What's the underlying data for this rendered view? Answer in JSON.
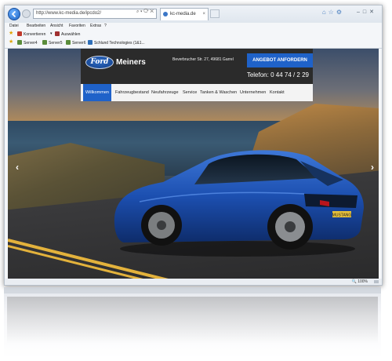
{
  "browser": {
    "address_url": "http://www.kc-media.de/ipcdo2/",
    "tab_title": "kc-media.de",
    "tab_close": "×",
    "menu": [
      "Datei",
      "Bearbeiten",
      "Ansicht",
      "Favoriten",
      "Extras",
      "?"
    ],
    "favorites_bar_1": {
      "items": [
        "Konvertieren",
        "Auswählen"
      ]
    },
    "favorites_bar_2": {
      "items": [
        "Server4",
        "Server5",
        "Server6",
        "Schlund Technologies (1&1..."
      ]
    },
    "zoom_level": "100%"
  },
  "site": {
    "logo_text": "Ford",
    "brand": "Meiners",
    "address": "Beverbrucher Str. 27, 49681 Garrel",
    "cta": "ANGEBOT ANFORDERN",
    "phone": "Telefon: 0 44 74 / 2 29",
    "nav": [
      {
        "label": "Willkommen",
        "active": true
      },
      {
        "label": "Fahrzeugbestand",
        "active": false
      },
      {
        "label": "Neufahrzeuge",
        "active": false
      },
      {
        "label": "Service",
        "active": false
      },
      {
        "label": "Tanken & Waschen",
        "active": false
      },
      {
        "label": "Unternehmen",
        "active": false
      },
      {
        "label": "Kontakt",
        "active": false
      }
    ],
    "plate_text": "MUSTANG"
  },
  "colors": {
    "accent": "#1f62c9",
    "header_bg": "#2b2b2b",
    "car_body": "#1c4fb0"
  },
  "icons": {
    "slider_prev": "chevron-left-icon",
    "slider_next": "chevron-right-icon"
  }
}
